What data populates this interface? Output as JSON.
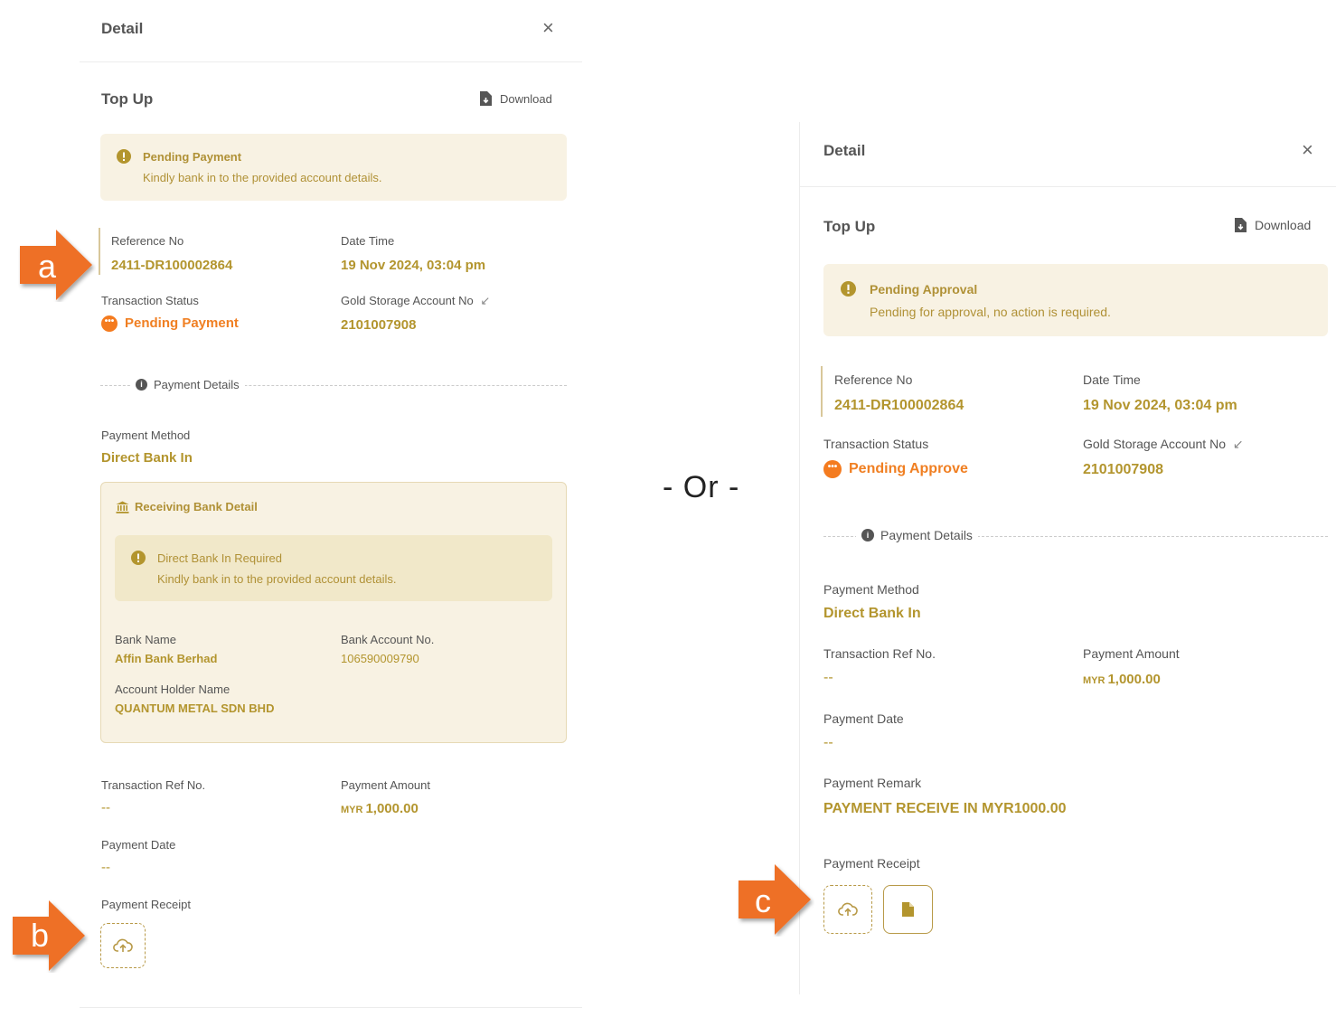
{
  "separator": "- Or -",
  "callouts": {
    "a": "a",
    "b": "b",
    "c": "c"
  },
  "colors": {
    "gold": "#b3952e",
    "orange": "#f07f22",
    "alert_bg": "#f8f2e3",
    "callout": "#ee7026"
  },
  "left_panel": {
    "header_title": "Detail",
    "close_label": "×",
    "section_title": "Top Up",
    "download_label": "Download",
    "alert": {
      "title": "Pending Payment",
      "message": "Kindly bank in to the provided account details."
    },
    "reference_no_label": "Reference No",
    "reference_no": "2411-DR100002864",
    "date_time_label": "Date Time",
    "date_time": "19 Nov 2024, 03:04 pm",
    "transaction_status_label": "Transaction Status",
    "transaction_status": "Pending Payment",
    "gold_storage_label": "Gold Storage Account No",
    "gold_storage_no": "2101007908",
    "payment_details_label": "Payment Details",
    "payment_method_label": "Payment Method",
    "payment_method": "Direct Bank In",
    "receiving_bank": {
      "title": "Receiving Bank Detail",
      "alert_title": "Direct Bank In Required",
      "alert_message": "Kindly bank in to the provided account details.",
      "bank_name_label": "Bank Name",
      "bank_name": "Affin Bank Berhad",
      "bank_account_label": "Bank Account No.",
      "bank_account": "106590009790",
      "holder_label": "Account Holder Name",
      "holder": "QUANTUM METAL SDN BHD"
    },
    "txn_ref_label": "Transaction Ref No.",
    "txn_ref": "--",
    "payment_amount_label": "Payment Amount",
    "currency": "MYR",
    "payment_amount": "1,000.00",
    "payment_date_label": "Payment Date",
    "payment_date": "--",
    "payment_receipt_label": "Payment Receipt"
  },
  "right_panel": {
    "header_title": "Detail",
    "close_label": "×",
    "section_title": "Top Up",
    "download_label": "Download",
    "alert": {
      "title": "Pending Approval",
      "message": "Pending for approval, no action is required."
    },
    "reference_no_label": "Reference No",
    "reference_no": "2411-DR100002864",
    "date_time_label": "Date Time",
    "date_time": "19 Nov 2024, 03:04 pm",
    "transaction_status_label": "Transaction Status",
    "transaction_status": "Pending Approve",
    "gold_storage_label": "Gold Storage Account No",
    "gold_storage_no": "2101007908",
    "payment_details_label": "Payment Details",
    "payment_method_label": "Payment Method",
    "payment_method": "Direct Bank In",
    "txn_ref_label": "Transaction Ref No.",
    "txn_ref": "--",
    "payment_amount_label": "Payment Amount",
    "currency": "MYR",
    "payment_amount": "1,000.00",
    "payment_date_label": "Payment Date",
    "payment_date": "--",
    "payment_remark_label": "Payment Remark",
    "payment_remark": "PAYMENT RECEIVE IN MYR1000.00",
    "payment_receipt_label": "Payment Receipt"
  }
}
